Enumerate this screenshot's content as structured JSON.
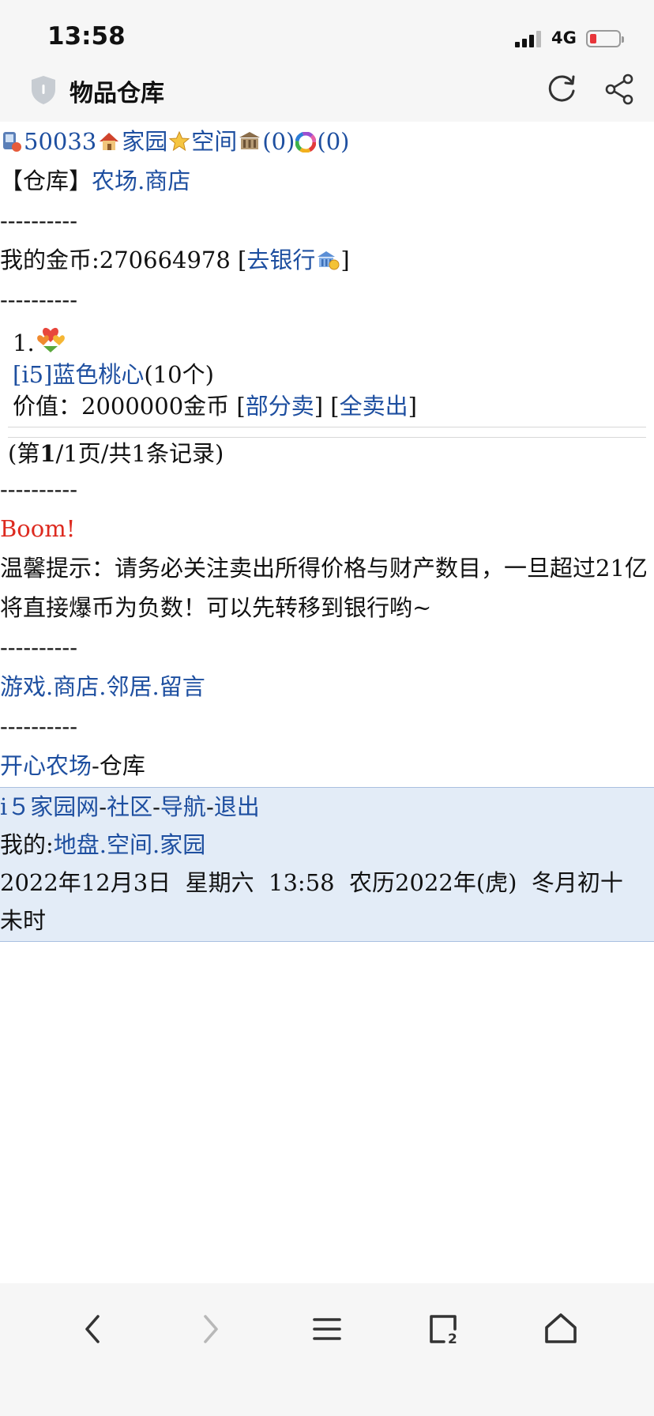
{
  "status_bar": {
    "time": "13:58",
    "network": "4G"
  },
  "browser": {
    "page_title": "物品仓库"
  },
  "top_nav": {
    "user_id": "50033",
    "home_link": "家园",
    "space_link": "空间",
    "count_a": "(0)",
    "count_b": "(0)"
  },
  "section": {
    "bracket_open": "【",
    "bracket_title": "仓库",
    "bracket_close": "】",
    "farm_link": "农场",
    "dot": ".",
    "shop_link": "商店"
  },
  "separator": "----------",
  "coins": {
    "label": "我的金币:270664978 [",
    "bank_link": "去银行",
    "close": "]"
  },
  "item": {
    "index": "1.",
    "name": "[i5]蓝色桃心",
    "quantity": "(10个)",
    "value_text": "价值：2000000金币 [",
    "sell_part": "部分卖",
    "mid": "] [",
    "sell_all": "全卖出",
    "end": "]"
  },
  "pagination": {
    "p1": "(第",
    "current": "1",
    "p2": "/1页/共1条记录)"
  },
  "boom": "Boom!",
  "warning": "温馨提示：请务必关注卖出所得价格与财产数目，一旦超过21亿将直接爆币为负数！可以先转移到银行哟~",
  "nav_links": [
    "游戏",
    "商店",
    "邻居",
    "留言"
  ],
  "farm_nav": {
    "link": "开心农场",
    "suffix": "-仓库"
  },
  "footer": {
    "site_link": "i５家园网",
    "dash": "-",
    "community_link": "社区",
    "navigation_link": "导航",
    "logout_link": "退出",
    "mine_label": "我的:",
    "land_link": "地盘",
    "space_link": "空间",
    "home_link": "家园",
    "date_line": "2022年12月3日  星期六  13:58  农历2022年(虎)  冬月初十  未时"
  },
  "colors": {
    "link": "#1e4fa0",
    "boom": "#dd2a1f",
    "footer_bg": "#e3ecf7"
  }
}
